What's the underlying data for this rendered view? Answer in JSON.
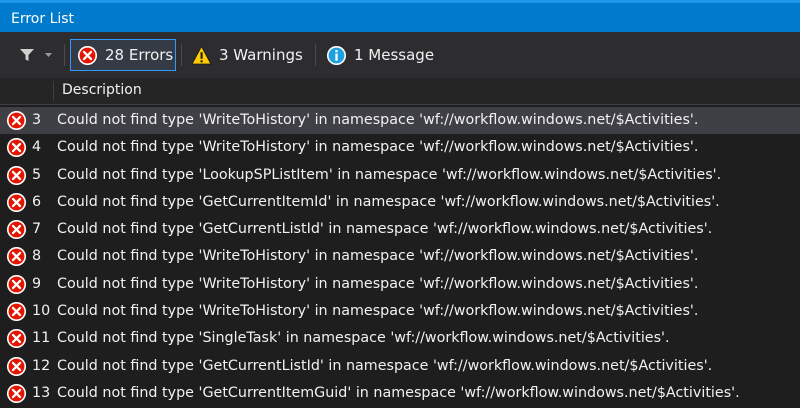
{
  "panel": {
    "title": "Error List"
  },
  "toolbar": {
    "errors_label": "28 Errors",
    "warnings_label": "3 Warnings",
    "messages_label": "1 Message"
  },
  "columns": {
    "description": "Description"
  },
  "rows": [
    {
      "num": "3",
      "description": "Could not find type 'WriteToHistory' in namespace 'wf://workflow.windows.net/$Activities'."
    },
    {
      "num": "4",
      "description": "Could not find type 'WriteToHistory' in namespace 'wf://workflow.windows.net/$Activities'."
    },
    {
      "num": "5",
      "description": "Could not find type 'LookupSPListItem' in namespace 'wf://workflow.windows.net/$Activities'."
    },
    {
      "num": "6",
      "description": "Could not find type 'GetCurrentItemId' in namespace 'wf://workflow.windows.net/$Activities'."
    },
    {
      "num": "7",
      "description": "Could not find type 'GetCurrentListId' in namespace 'wf://workflow.windows.net/$Activities'."
    },
    {
      "num": "8",
      "description": "Could not find type 'WriteToHistory' in namespace 'wf://workflow.windows.net/$Activities'."
    },
    {
      "num": "9",
      "description": "Could not find type 'WriteToHistory' in namespace 'wf://workflow.windows.net/$Activities'."
    },
    {
      "num": "10",
      "description": "Could not find type 'WriteToHistory' in namespace 'wf://workflow.windows.net/$Activities'."
    },
    {
      "num": "11",
      "description": "Could not find type 'SingleTask' in namespace 'wf://workflow.windows.net/$Activities'."
    },
    {
      "num": "12",
      "description": "Could not find type 'GetCurrentListId' in namespace 'wf://workflow.windows.net/$Activities'."
    },
    {
      "num": "13",
      "description": "Could not find type 'GetCurrentItemGuid' in namespace 'wf://workflow.windows.net/$Activities'."
    }
  ],
  "icons": {
    "filter": "filter-icon",
    "error": "error-icon",
    "warning": "warning-icon",
    "message": "info-icon"
  },
  "colors": {
    "accent": "#007acc",
    "error": "#e51400",
    "warning": "#ffcc00",
    "info": "#1ba1e2"
  }
}
